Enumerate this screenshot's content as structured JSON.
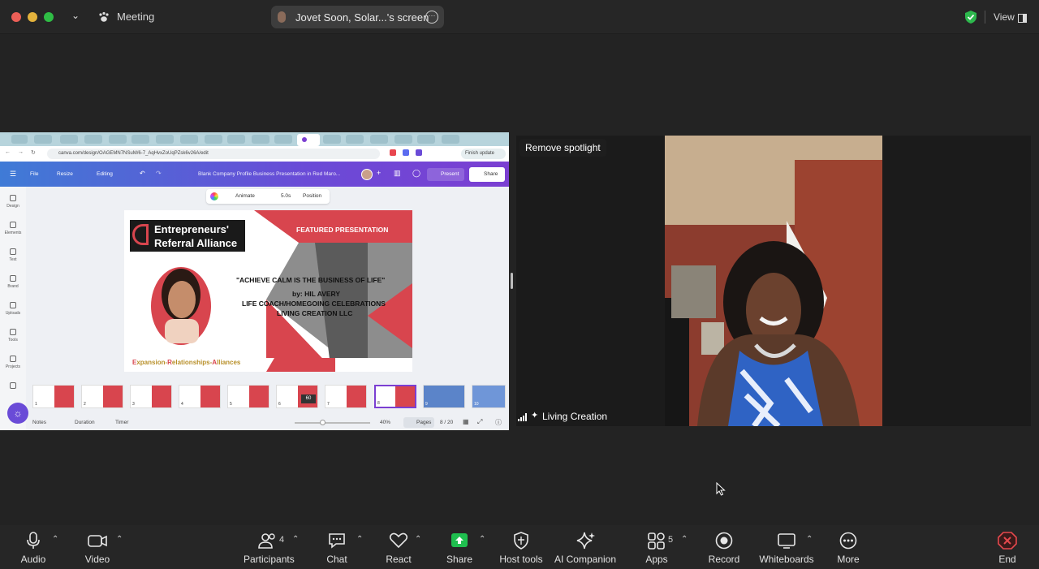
{
  "titlebar": {
    "app_title": "Meeting",
    "share_pill_label": "Jovet Soon, Solar...'s screen",
    "view_label": "View"
  },
  "shared_screen": {
    "url": "canva.com/design/OAGEMN7NSuM/6-7_AqHvxZoUqPZsk6v26A/edit",
    "finish_update": "Finish update",
    "menu": {
      "file": "File",
      "resize": "Resize",
      "editing": "Editing",
      "doc_title": "Blank Company Profile Business Presentation in Red Maro...",
      "present": "Present",
      "share": "Share"
    },
    "sidebar": [
      "Design",
      "Elements",
      "Text",
      "Brand",
      "Uploads",
      "Tools",
      "Projects"
    ],
    "toolchip": {
      "animate": "Animate",
      "duration": "5.0s",
      "position": "Position"
    },
    "slide": {
      "logo_line1": "Entrepreneurs'",
      "logo_line2": "Referral Alliance",
      "featured": "FEATURED PRESENTATION",
      "quote": "\"ACHIEVE CALM IS THE BUSINESS OF LIFE\"",
      "by": "by: HIL AVERY",
      "role": "LIFE COACH/HOMEGOING CELEBRATIONS",
      "company": "LIVING CREATION LLC",
      "tagline_e": "E",
      "tagline_1": "xpansion-",
      "tagline_r": "R",
      "tagline_2": "elationships-",
      "tagline_a": "A",
      "tagline_3": "lliances"
    },
    "thumbnails": [
      "1",
      "2",
      "3",
      "4",
      "5",
      "6",
      "7",
      "8",
      "9",
      "10"
    ],
    "thumb_badge": "60",
    "bottom": {
      "notes": "Notes",
      "duration": "Duration",
      "timer": "Timer",
      "zoom": "40%",
      "pages": "Pages",
      "page_count": "8 / 20"
    }
  },
  "video": {
    "remove_spotlight": "Remove spotlight",
    "participant_name": "Living Creation"
  },
  "toolbar": {
    "audio": "Audio",
    "video": "Video",
    "participants": "Participants",
    "participants_count": "4",
    "chat": "Chat",
    "react": "React",
    "share": "Share",
    "host_tools": "Host tools",
    "ai_companion": "AI Companion",
    "apps": "Apps",
    "apps_count": "5",
    "record": "Record",
    "whiteboards": "Whiteboards",
    "more": "More",
    "end": "End"
  },
  "colors": {
    "share_green": "#1fbf4f",
    "end_red": "#e5484d",
    "canva_purple": "#7b3fd2",
    "slide_red": "#d8454e"
  }
}
